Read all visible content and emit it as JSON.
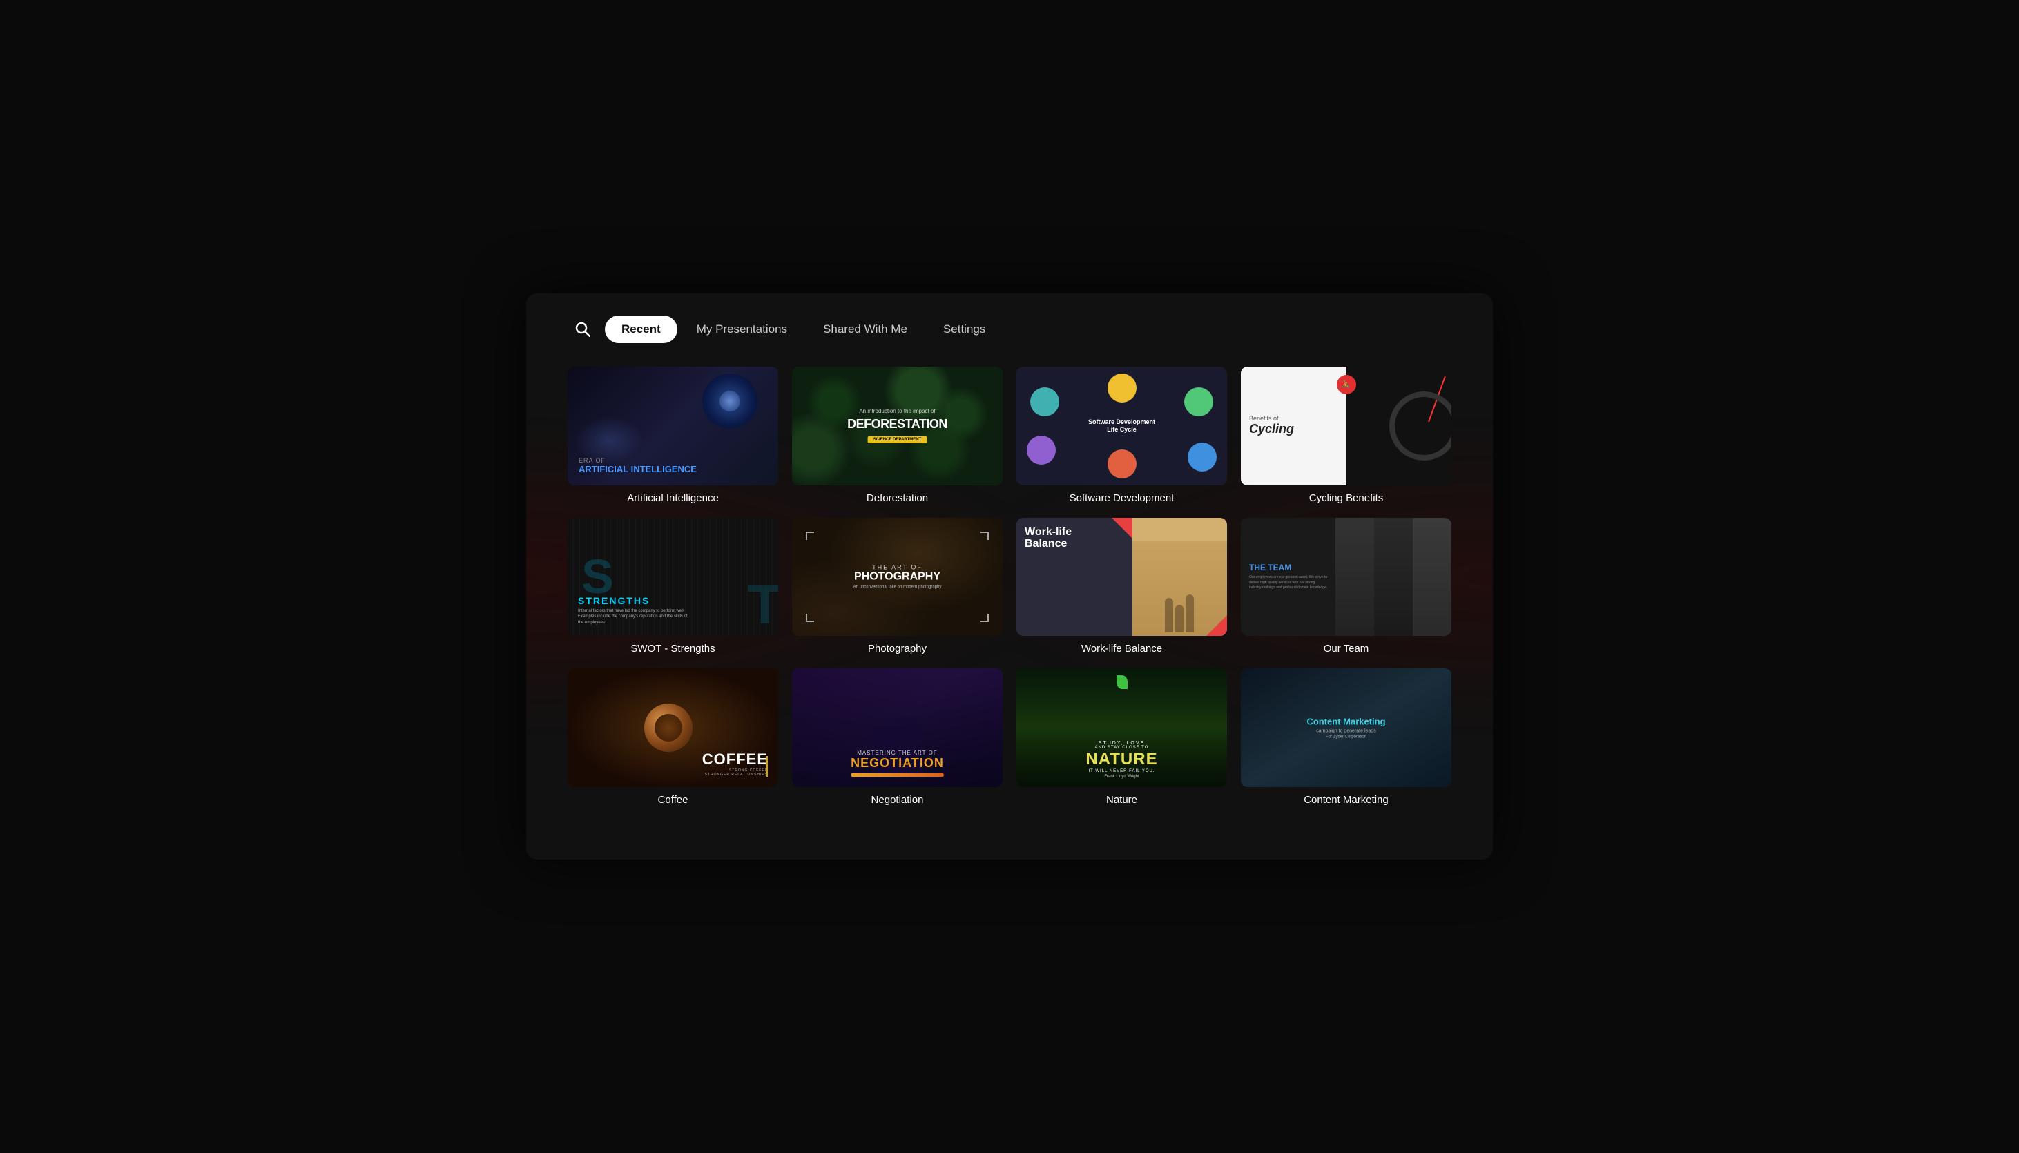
{
  "nav": {
    "search_placeholder": "Search",
    "tabs": [
      {
        "id": "recent",
        "label": "Recent",
        "active": true
      },
      {
        "id": "my-presentations",
        "label": "My Presentations",
        "active": false
      },
      {
        "id": "shared-with-me",
        "label": "Shared With Me",
        "active": false
      },
      {
        "id": "settings",
        "label": "Settings",
        "active": false
      }
    ]
  },
  "presentations": [
    {
      "id": "ai",
      "title": "Artificial Intelligence",
      "thumbnail_type": "ai"
    },
    {
      "id": "deforestation",
      "title": "Deforestation",
      "thumbnail_type": "deforestation"
    },
    {
      "id": "software-dev",
      "title": "Software Development",
      "thumbnail_type": "software"
    },
    {
      "id": "cycling",
      "title": "Cycling Benefits",
      "thumbnail_type": "cycling"
    },
    {
      "id": "swot",
      "title": "SWOT - Strengths",
      "thumbnail_type": "swot"
    },
    {
      "id": "photography",
      "title": "Photography",
      "thumbnail_type": "photography"
    },
    {
      "id": "worklife",
      "title": "Work-life Balance",
      "thumbnail_type": "worklife"
    },
    {
      "id": "team",
      "title": "Our Team",
      "thumbnail_type": "team"
    },
    {
      "id": "coffee",
      "title": "Coffee",
      "thumbnail_type": "coffee"
    },
    {
      "id": "negotiation",
      "title": "Negotiation",
      "thumbnail_type": "negotiation"
    },
    {
      "id": "nature",
      "title": "Nature",
      "thumbnail_type": "nature"
    },
    {
      "id": "content-marketing",
      "title": "Content Marketing",
      "thumbnail_type": "content"
    }
  ],
  "thumbnails": {
    "ai": {
      "era_label": "ERA OF",
      "main_label": "ARTIFICIAL INTELLIGENCE"
    },
    "deforestation": {
      "intro": "An introduction to the impact of",
      "main": "DEFORESTATION",
      "badge": "SCIENCE DEPARTMENT"
    },
    "software": {
      "title_line1": "Software Development",
      "title_line2": "Life Cycle"
    },
    "cycling": {
      "benefits_label": "Benefits of",
      "main_label": "Cycling"
    },
    "swot": {
      "strengths_label": "STRENGTHS",
      "desc": "Internal factors that have led the company to perform well. Examples include the company's reputation and the skills of the employees."
    },
    "photography": {
      "art_of": "THE ART OF",
      "main": "PHOTOGRAPHY",
      "subtitle": "An unconventional take on modern photography"
    },
    "worklife": {
      "title_line1": "Work-life",
      "title_line2": "Balance"
    },
    "team": {
      "label": "THE TEAM",
      "desc": "Our employees are our greatest asset. We strive to deliver high quality services with our strong industry rankings and profound domain knowledge."
    },
    "coffee": {
      "main": "COFFEE",
      "sub": "STRONG COFFEE\nSTRONGER RELATIONSHIPS"
    },
    "negotiation": {
      "mastering": "Mastering the art of",
      "main": "NEGOTIATION"
    },
    "nature": {
      "study": "STUDY, LOVE",
      "stay": "AND STAY CLOSE TO",
      "main": "NATURE",
      "never": "IT WILL NEVER FAIL YOU.",
      "author": "Frank Lloyd Wright"
    },
    "content": {
      "main": "Content Marketing",
      "sub": "campaign to generate leads",
      "company": "For Zyber Corporation"
    }
  }
}
